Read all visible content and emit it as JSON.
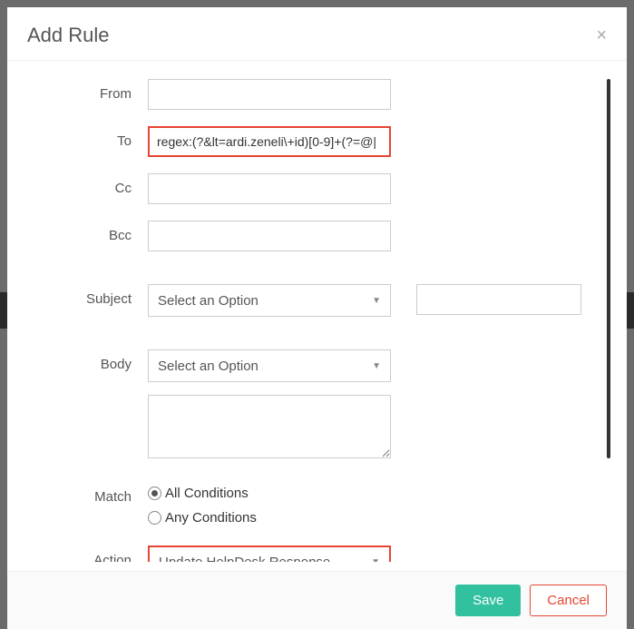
{
  "modal": {
    "title": "Add Rule",
    "close_icon": "×"
  },
  "fields": {
    "from": {
      "label": "From",
      "value": ""
    },
    "to": {
      "label": "To",
      "value": "regex:(?&lt=ardi.zeneli\\+id)[0-9]+(?=@|"
    },
    "cc": {
      "label": "Cc",
      "value": ""
    },
    "bcc": {
      "label": "Bcc",
      "value": ""
    },
    "subject": {
      "label": "Subject",
      "select_value": "Select an Option",
      "text_value": ""
    },
    "body": {
      "label": "Body",
      "select_value": "Select an Option",
      "text_value": ""
    },
    "match": {
      "label": "Match",
      "options": {
        "all": "All Conditions",
        "any": "Any Conditions"
      },
      "selected": "all"
    },
    "action": {
      "label": "Action",
      "select_value": "Update HelpDesk Response"
    }
  },
  "footer": {
    "save_label": "Save",
    "cancel_label": "Cancel"
  }
}
